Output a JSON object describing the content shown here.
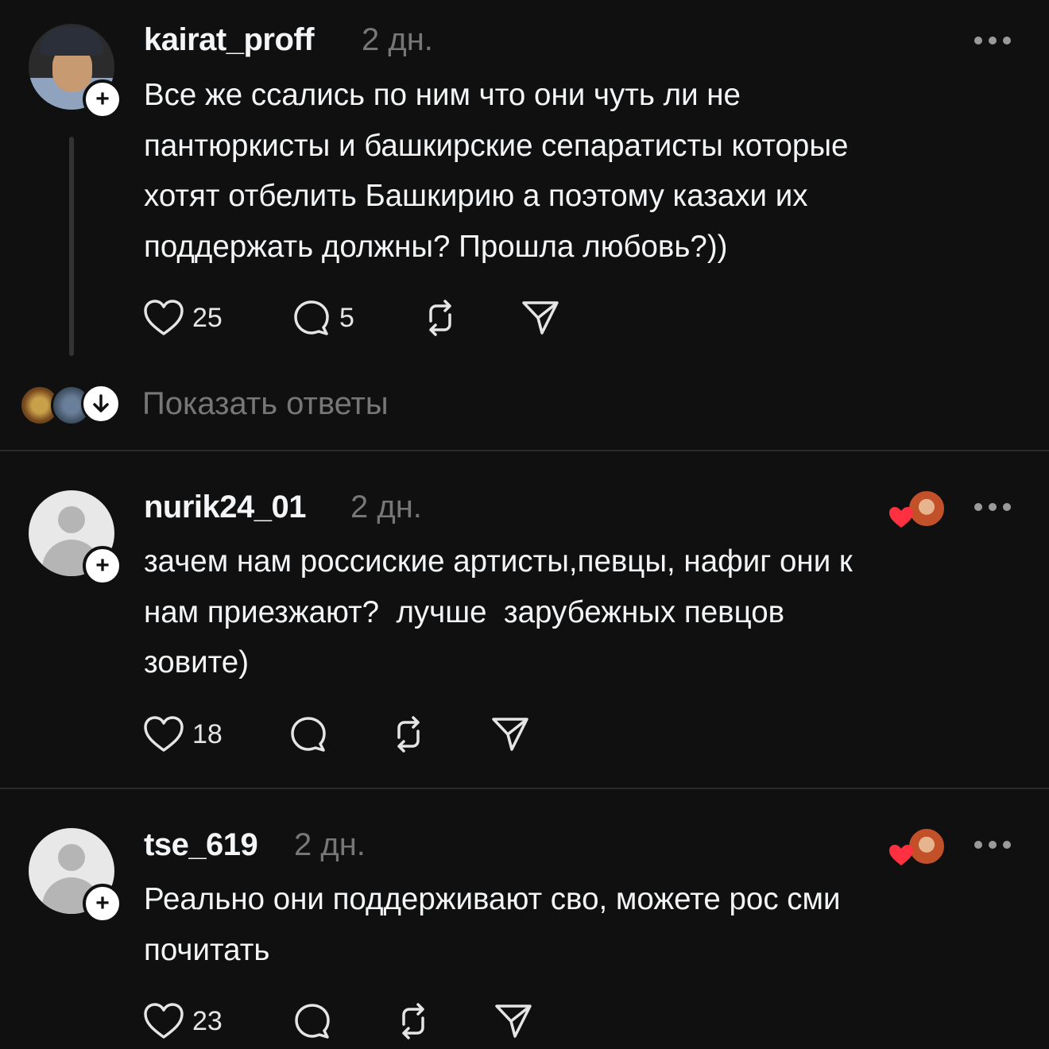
{
  "posts": [
    {
      "username": "kairat_proff",
      "time": "2 дн.",
      "text": "Все же ссались по ним что они чуть ли не\nпантюркисты и башкирские сепаратисты которые\nхотят отбелить Башкирию а поэтому казахи их\nподдержать должны? Прошла любовь?))",
      "likes": "25",
      "replies": "5",
      "show_replies_label": "Показать ответы"
    },
    {
      "username": "nurik24_01",
      "time": "2 дн.",
      "text": "зачем нам россиские артисты,певцы, нафиг они к\nнам приезжают?  лучше  зарубежных певцов\nзовите)",
      "likes": "18",
      "replies": ""
    },
    {
      "username": "tse_619",
      "time": "2 дн.",
      "text": "Реально они поддерживают сво, можете рос сми\nпочитать",
      "likes": "23",
      "replies": ""
    }
  ],
  "icons": {
    "like": "heart-icon",
    "reply": "comment-icon",
    "repost": "repost-icon",
    "share": "send-icon",
    "more": "more-icon",
    "follow": "plus-icon",
    "expand": "arrow-down-icon"
  },
  "colors": {
    "background": "#101010",
    "text": "#f3f5f7",
    "muted": "#777777",
    "liked_heart": "#ff3040"
  }
}
